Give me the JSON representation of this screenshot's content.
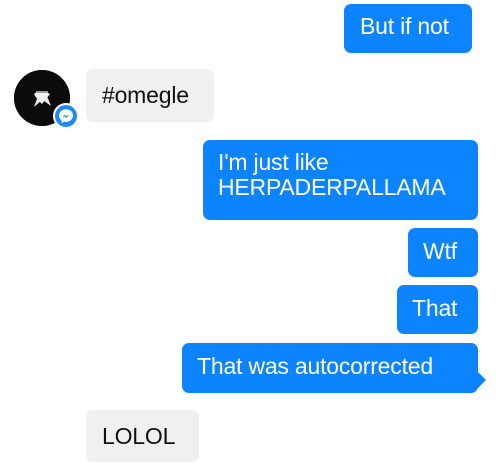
{
  "conversation": {
    "messages": [
      {
        "direction": "outgoing",
        "text": "But if not"
      },
      {
        "direction": "incoming",
        "text": "#omegle"
      },
      {
        "direction": "outgoing",
        "text": "I'm just like HERPADERPALLAMA"
      },
      {
        "direction": "outgoing",
        "text": "Wtf"
      },
      {
        "direction": "outgoing",
        "text": "That"
      },
      {
        "direction": "outgoing",
        "text": "That was autocorrected"
      },
      {
        "direction": "incoming",
        "text": "LOLOL"
      }
    ]
  },
  "contact": {
    "avatar_icon": "contact-avatar",
    "badge_icon": "messenger-icon"
  },
  "colors": {
    "outgoing_bubble": "#0d84ff",
    "incoming_bubble": "#f0f0f0",
    "badge": "#1e8bf5"
  }
}
